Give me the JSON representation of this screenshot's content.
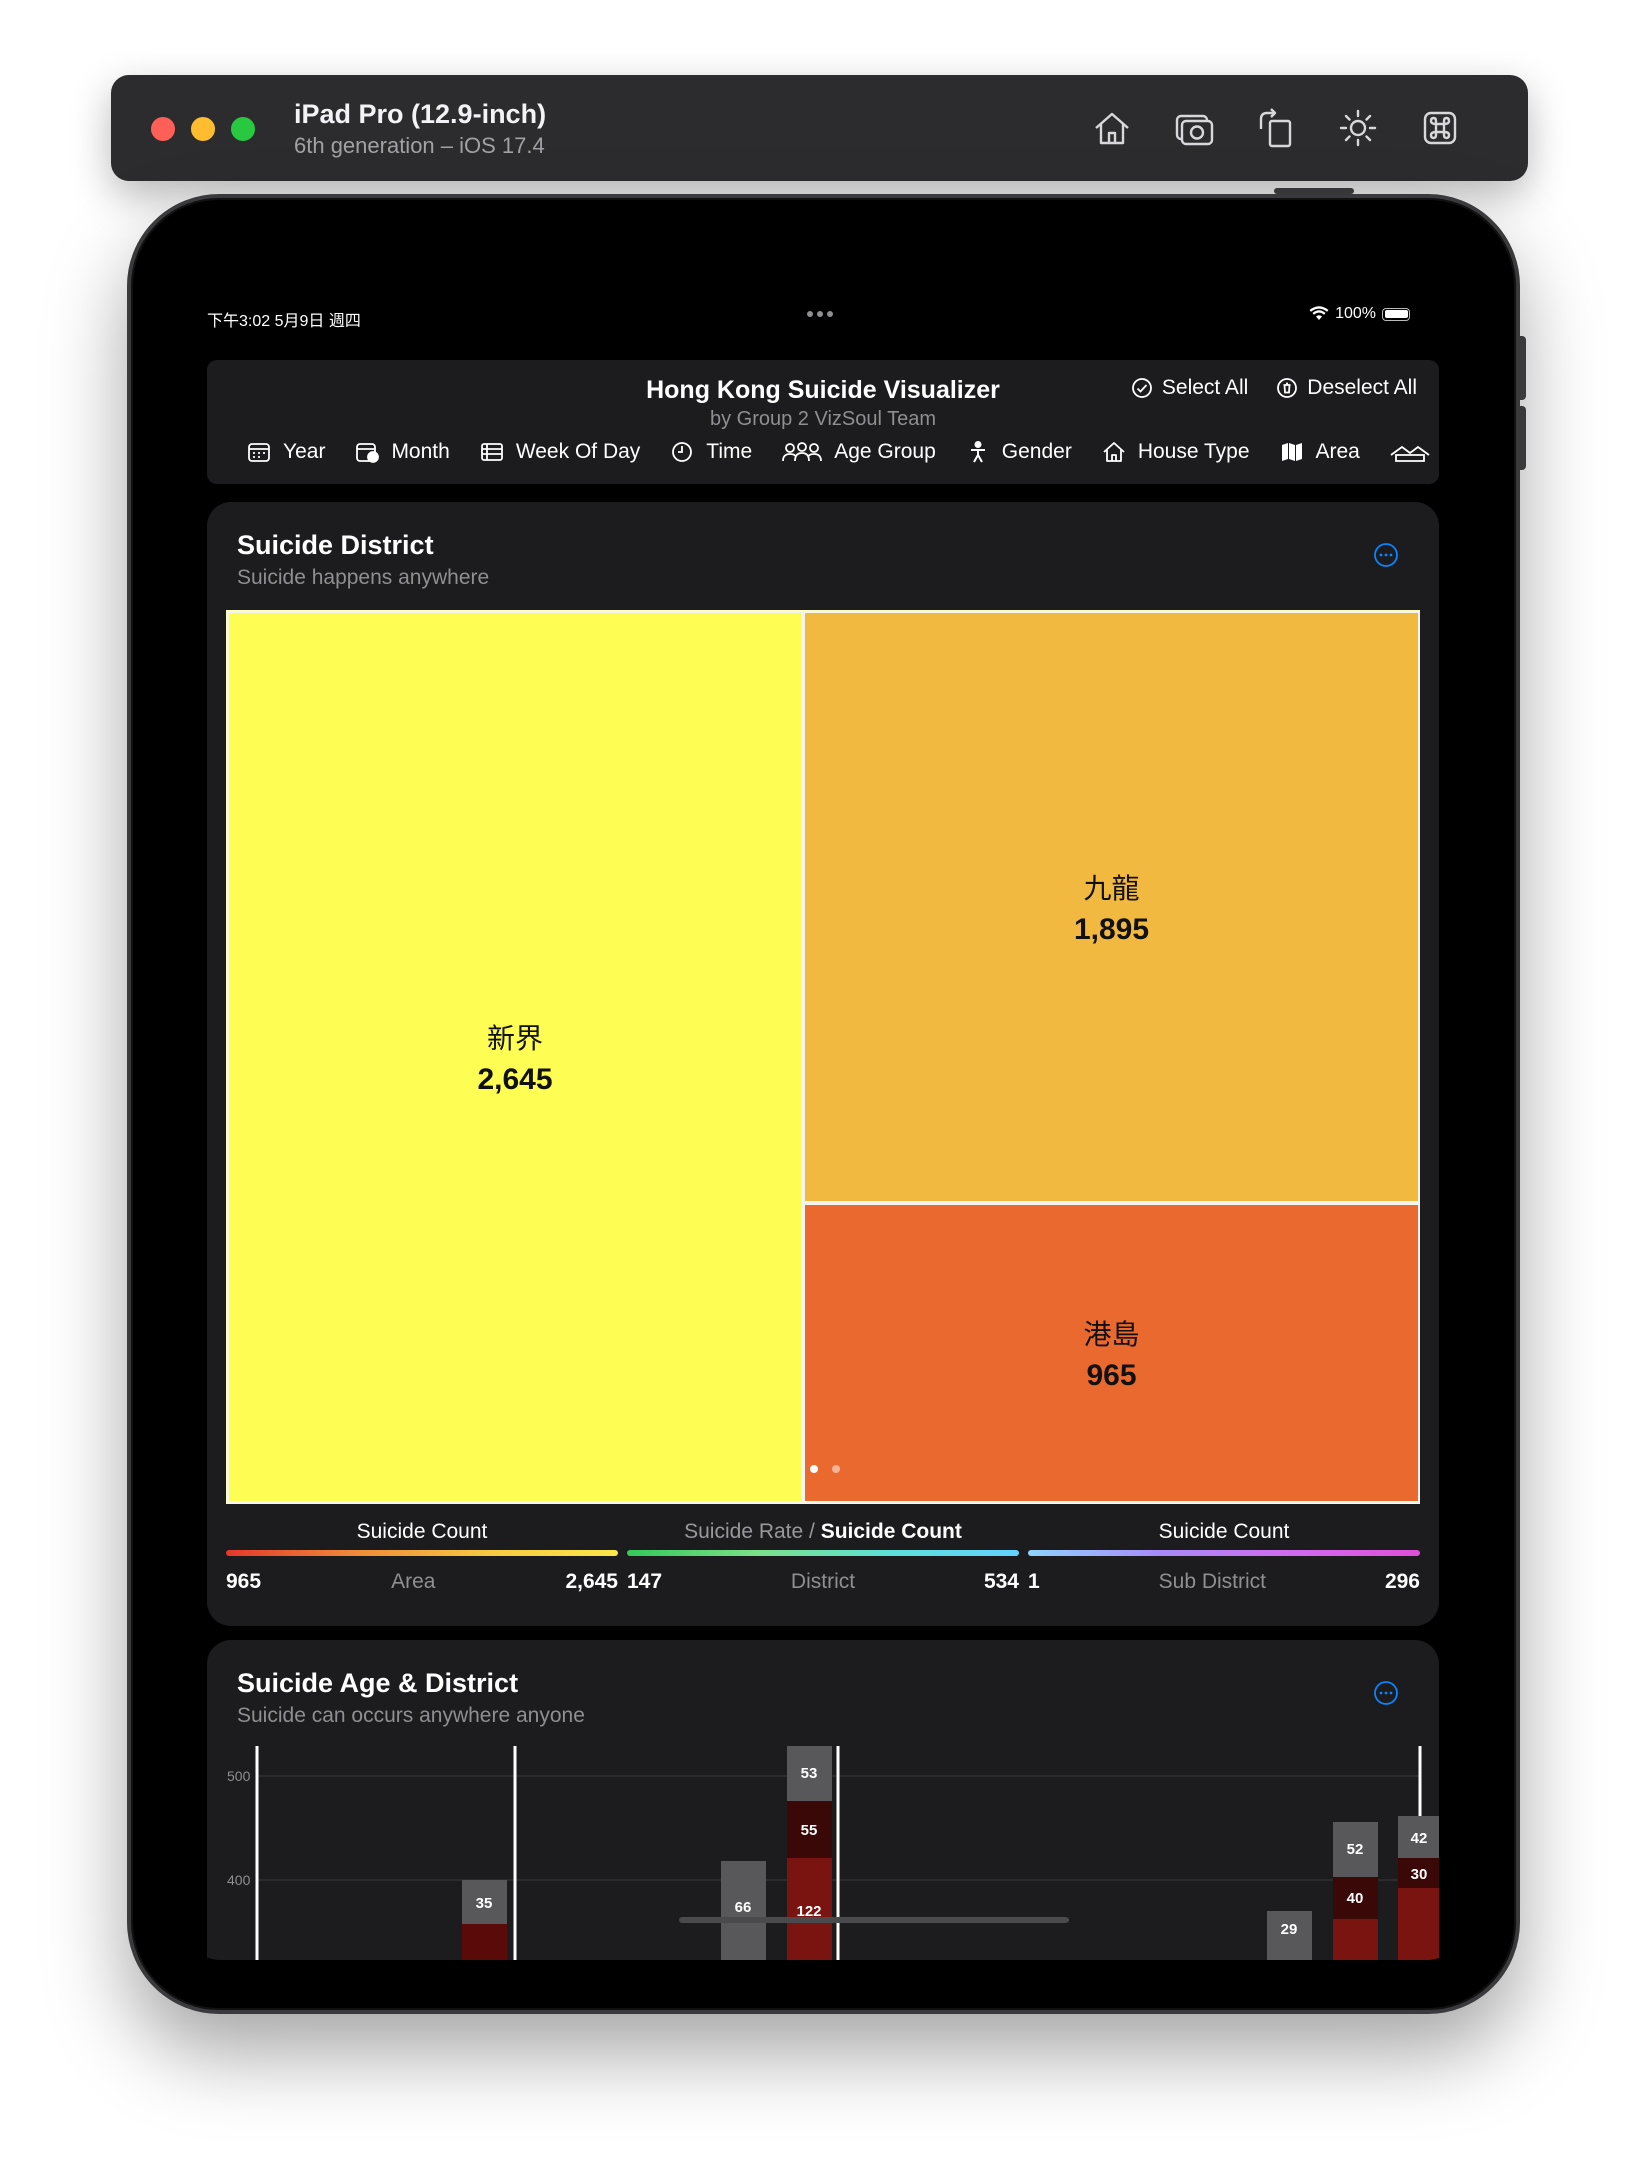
{
  "simulator": {
    "device_name": "iPad Pro (12.9-inch)",
    "device_detail": "6th generation – iOS 17.4",
    "tools": [
      "home-icon",
      "screenshot-icon",
      "rotate-icon",
      "appearance-icon",
      "command-icon"
    ]
  },
  "status_bar": {
    "time": "下午3:02 5月9日 週四",
    "battery": "100%"
  },
  "header": {
    "title": "Hong Kong Suicide Visualizer",
    "subtitle": "by Group 2 VizSoul Team",
    "select_all": "Select All",
    "deselect_all": "Deselect All",
    "filters": [
      {
        "label": "Year",
        "icon": "calendar-icon"
      },
      {
        "label": "Month",
        "icon": "calendar-clock-icon"
      },
      {
        "label": "Week Of Day",
        "icon": "list-icon"
      },
      {
        "label": "Time",
        "icon": "clock-icon"
      },
      {
        "label": "Age Group",
        "icon": "people-icon"
      },
      {
        "label": "Gender",
        "icon": "person-icon"
      },
      {
        "label": "House Type",
        "icon": "house-icon"
      },
      {
        "label": "Area",
        "icon": "map-icon"
      }
    ]
  },
  "district_card": {
    "title": "Suicide District",
    "subtitle": "Suicide happens anywhere",
    "treemap": [
      {
        "name": "新界",
        "value": "2,645",
        "color": "#fdfd53"
      },
      {
        "name": "九龍",
        "value": "1,895",
        "color": "#f2b941"
      },
      {
        "name": "港島",
        "value": "965",
        "color": "#ea692f"
      }
    ],
    "legends": [
      {
        "title_dim": "",
        "title": "Suicide Count",
        "min": "965",
        "label": "Area",
        "max": "2,645"
      },
      {
        "title_dim": "Suicide Rate / ",
        "title": "Suicide Count",
        "min": "147",
        "label": "District",
        "max": "534"
      },
      {
        "title_dim": "",
        "title": "Suicide Count",
        "min": "1",
        "label": "Sub District",
        "max": "296"
      }
    ]
  },
  "age_card": {
    "title": "Suicide Age & District",
    "subtitle": "Suicide can occurs anywhere anyone"
  },
  "chart_data": {
    "type": "bar",
    "y_ticks": [
      "500",
      "400"
    ],
    "bar_labels": [
      "35",
      "66",
      "53",
      "55",
      "122",
      "29",
      "52",
      "40",
      "42",
      "30"
    ]
  }
}
